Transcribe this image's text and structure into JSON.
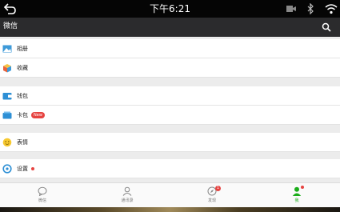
{
  "status_bar": {
    "time": "下午6:21"
  },
  "app_bar": {
    "title": "微信"
  },
  "menu": {
    "album": "相册",
    "favorites": "收藏",
    "wallet": "钱包",
    "cards": "卡包",
    "cards_badge": "New",
    "stickers": "表情",
    "settings": "设置"
  },
  "tabs": [
    {
      "label": "微信"
    },
    {
      "label": "通讯录"
    },
    {
      "label": "发现",
      "badge": "1"
    },
    {
      "label": "我"
    }
  ],
  "colors": {
    "accent_green": "#1aad19",
    "badge_red": "#e64340",
    "app_bar": "#2b2b2d"
  }
}
